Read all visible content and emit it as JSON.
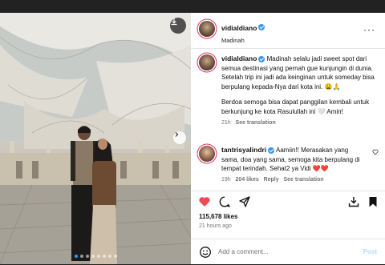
{
  "post": {
    "username": "vidialdiano",
    "location": "Madinah",
    "more_label": "···"
  },
  "caption": {
    "username": "vidialdiano",
    "text": "Madinah selalu jadi sweet spot dari semua destinasi yang pernah gue kunjungin di dunia. Setelah trip ini jadi ada keinginan untuk someday bisa berpulang kepada-Nya dari kota ini. 😩🙏",
    "text2": "Berdoa semoga bisa dapat panggilan kembali untuk berkunjung ke kota Rasulullah ini 🤍 Amin!",
    "time": "21h",
    "see_translation": "See translation"
  },
  "comments": [
    {
      "username": "tantrisyalindri",
      "text": "Aamiin!! Merasakan yang sama, doa yang sama, semoga kita berpulang di tempat terindah. Sehat2 ya Vidi ❤️❤️",
      "time": "19h",
      "likes": "204 likes",
      "reply": "Reply",
      "see_translation": "See translation"
    }
  ],
  "stats": {
    "likes": "115,678 likes",
    "posted_ago": "21 hours ago"
  },
  "comment_input": {
    "placeholder": "Add a comment...",
    "post_label": "Post"
  },
  "carousel": {
    "total": 8,
    "active_index": 0
  },
  "colors": {
    "like_red": "#ed4956",
    "verified_blue": "#3897f0",
    "post_disabled": "#b3dbff"
  }
}
